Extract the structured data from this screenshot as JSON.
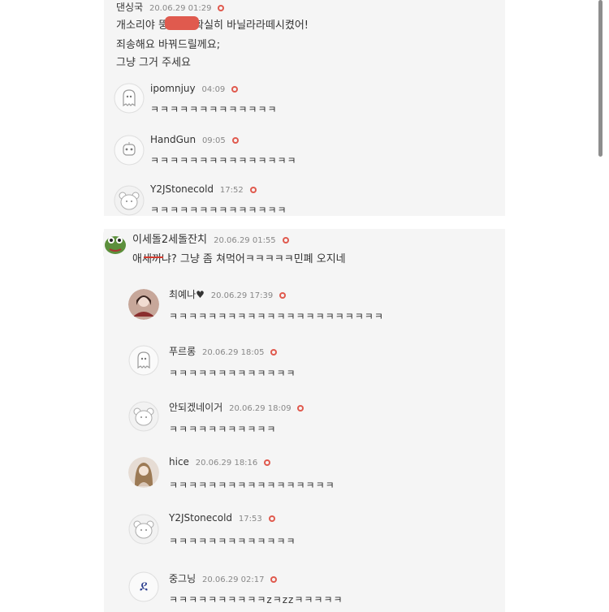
{
  "post1": {
    "author": "댄싱국",
    "date": "20.06.29 01:29",
    "lines": [
      "개소리야    뚱아 나 확실히 바닐라라떼시켰어!",
      "죄송해요 바꿔드릴께요;",
      "그냥 그거 주세요"
    ],
    "replies": [
      {
        "name": "ipomnjuy",
        "time": "04:09",
        "text": "ㅋㅋㅋㅋㅋㅋㅋㅋㅋㅋㅋㅋㅋ",
        "avatar_icon": "ghost-icon"
      },
      {
        "name": "HandGun",
        "time": "09:05",
        "text": "ㅋㅋㅋㅋㅋㅋㅋㅋㅋㅋㅋㅋㅋㅋㅋ",
        "avatar_icon": "robot-icon"
      },
      {
        "name": "Y2JStonecold",
        "time": "17:52",
        "text": "ㅋㅋㅋㅋㅋㅋㅋㅋㅋㅋㅋㅋㅋㅋ",
        "avatar_icon": "bear-icon"
      }
    ]
  },
  "post2": {
    "author": "이세돌2세돌잔치",
    "date": "20.06.29 01:55",
    "body": "애새끼냐? 그냥 좀 쳐먹어ㅋㅋㅋㅋㅋ민폐 오지네",
    "replies": [
      {
        "name": "최예나♥",
        "time": "20.06.29 17:39",
        "text": "ㅋㅋㅋㅋㅋㅋㅋㅋㅋㅋㅋㅋㅋㅋㅋㅋㅋㅋㅋㅋㅋㅋ",
        "avatar_icon": "photo-avatar-icon"
      },
      {
        "name": "푸르롱",
        "time": "20.06.29 18:05",
        "text": "ㅋㅋㅋㅋㅋㅋㅋㅋㅋㅋㅋㅋㅋ",
        "avatar_icon": "ghost-icon"
      },
      {
        "name": "안되겠네이거",
        "time": "20.06.29 18:09",
        "text": "ㅋㅋㅋㅋㅋㅋㅋㅋㅋㅋㅋ",
        "avatar_icon": "bear-icon"
      },
      {
        "name": "hice",
        "time": "20.06.29 18:16",
        "text": "ㅋㅋㅋㅋㅋㅋㅋㅋㅋㅋㅋㅋㅋㅋㅋㅋㅋ",
        "avatar_icon": "photo-avatar-icon"
      },
      {
        "name": "Y2JStonecold",
        "time": "17:53",
        "text": "ㅋㅋㅋㅋㅋㅋㅋㅋㅋㅋㅋㅋㅋ",
        "avatar_icon": "bear-icon"
      },
      {
        "name": "중그닝",
        "time": "20.06.29 02:17",
        "text": "ㅋㅋㅋㅋㅋㅋㅋㅋㅋㅋzㅋzzㅋㅋㅋㅋㅋ",
        "avatar_icon": "logo-avatar-icon"
      }
    ]
  },
  "colors": {
    "accent_dot": "#e05a4e",
    "panel": "#f5f5f5"
  }
}
